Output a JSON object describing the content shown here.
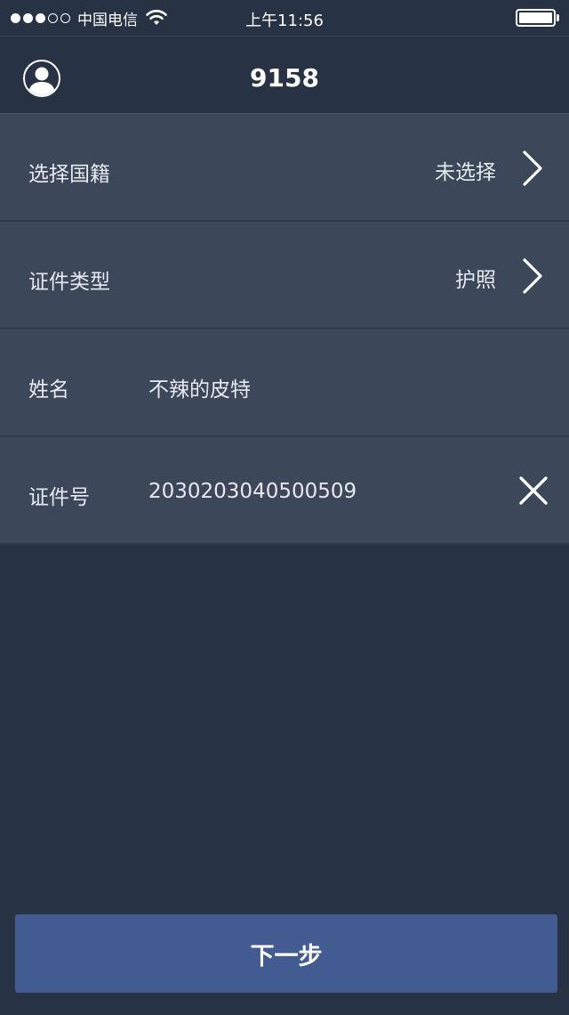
{
  "status_bar": {
    "carrier": "中国电信",
    "time": "上午11:56",
    "signal_filled": 3,
    "signal_total": 5,
    "battery_level": 1.0
  },
  "header": {
    "title": "9158",
    "avatar_icon": "user-avatar-icon"
  },
  "form": {
    "nationality": {
      "label": "选择国籍",
      "value": "未选择"
    },
    "id_type": {
      "label": "证件类型",
      "value": "护照"
    },
    "name": {
      "label": "姓名",
      "value": "不辣的皮特"
    },
    "id_number": {
      "label": "证件号",
      "value": "2030203040500509"
    }
  },
  "footer": {
    "next_label": "下一步"
  },
  "colors": {
    "background": "#283245",
    "row_background": "#3c4759",
    "button": "#425b90"
  }
}
